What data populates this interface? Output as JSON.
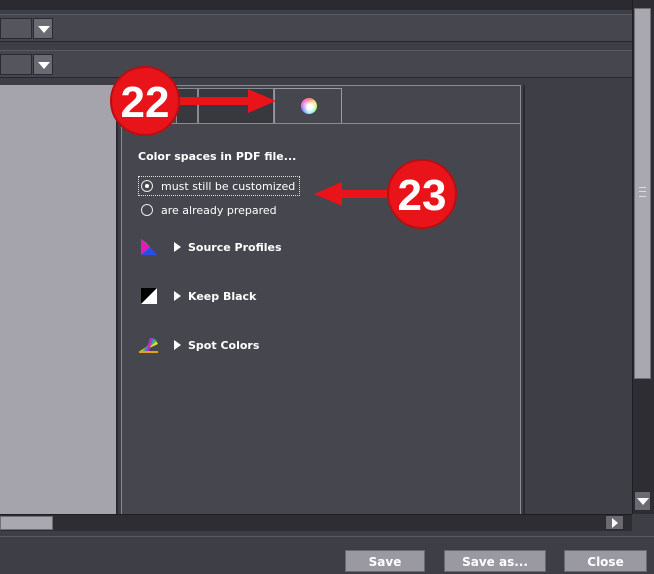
{
  "panel": {
    "section_title": "Color spaces in PDF file...",
    "radio_options": [
      {
        "label": "must still be customized",
        "checked": true
      },
      {
        "label": "are already prepared",
        "checked": false
      }
    ],
    "sections": [
      {
        "label": "Source Profiles",
        "icon": "color-triangle-icon"
      },
      {
        "label": "Keep Black",
        "icon": "black-white-square-icon"
      },
      {
        "label": "Spot Colors",
        "icon": "color-swatch-fan-icon"
      }
    ],
    "active_tab_icon": "color-wheel-icon"
  },
  "footer": {
    "save": "Save",
    "save_as": "Save as...",
    "close": "Close"
  },
  "callouts": {
    "c22": "22",
    "c23": "23"
  },
  "colors": {
    "callout_red": "#e8141a",
    "background": "#3e3e47",
    "panel": "#46464f",
    "button": "#9a99a2"
  }
}
